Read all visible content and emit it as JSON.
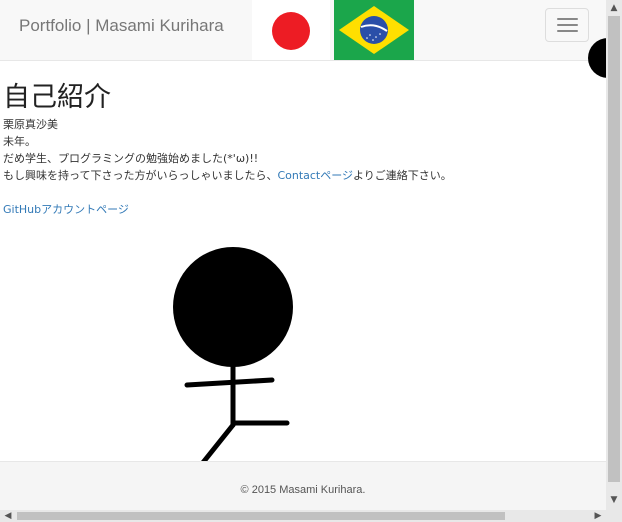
{
  "navbar": {
    "brand": "Portfolio | Masami Kurihara",
    "flags": [
      "japan-flag",
      "brazil-flag"
    ],
    "menu_icon": "hamburger-menu-icon"
  },
  "main": {
    "title": "自己紹介",
    "lines": [
      "栗原真沙美",
      "未年。",
      "だめ学生、プログラミングの勉強始めました(*'ω)!!"
    ],
    "contact_prefix": "もし興味を持って下さった方がいらっしゃいましたら、",
    "contact_link": "Contactページ",
    "contact_suffix": "よりご連絡下さい。",
    "github_link": "GitHubアカウントページ"
  },
  "footer": {
    "text": "© 2015 Masami Kurihara."
  },
  "colors": {
    "link": "#337ab7",
    "japan_red": "#ed1c24",
    "brazil_green": "#1ba64b",
    "brazil_yellow": "#ffdf00",
    "brazil_blue": "#2a4fa8"
  }
}
